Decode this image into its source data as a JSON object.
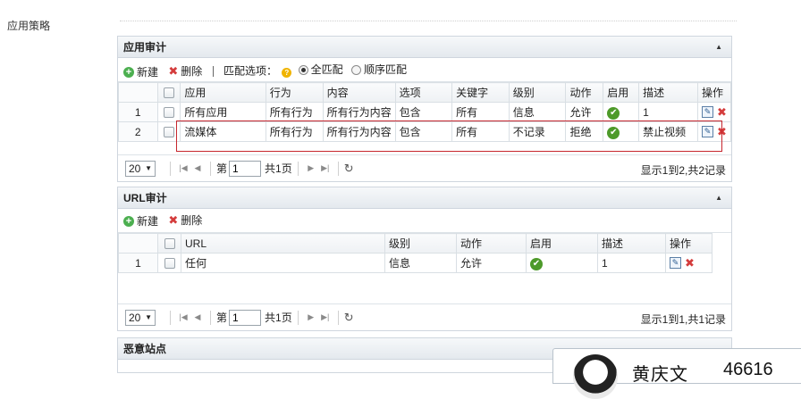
{
  "page": {
    "section_label": "应用策略"
  },
  "app_audit": {
    "title": "应用审计",
    "toolbar": {
      "new_label": "新建",
      "delete_label": "删除",
      "match_label": "匹配选项：",
      "help_glyph": "?",
      "match_all_label": "全匹配",
      "match_seq_label": "顺序匹配"
    },
    "columns": [
      "应用",
      "行为",
      "内容",
      "选项",
      "关键字",
      "级别",
      "动作",
      "启用",
      "描述",
      "操作"
    ],
    "rows": [
      {
        "num": "1",
        "app": "所有应用",
        "behavior": "所有行为",
        "content": "所有行为内容",
        "option": "包含",
        "keyword": "所有",
        "level": "信息",
        "action": "允许",
        "desc": "1"
      },
      {
        "num": "2",
        "app": "流媒体",
        "behavior": "所有行为",
        "content": "所有行为内容",
        "option": "包含",
        "keyword": "所有",
        "level": "不记录",
        "action": "拒绝",
        "desc": "禁止视频"
      }
    ],
    "pager": {
      "page_size": "20",
      "page_prefix": "第",
      "page_value": "1",
      "page_suffix": "共1页",
      "info": "显示1到2,共2记录"
    }
  },
  "url_audit": {
    "title": "URL审计",
    "toolbar": {
      "new_label": "新建",
      "delete_label": "删除"
    },
    "columns": [
      "URL",
      "级别",
      "动作",
      "启用",
      "描述",
      "操作"
    ],
    "rows": [
      {
        "num": "1",
        "url": "任何",
        "level": "信息",
        "action": "允许",
        "desc": "1"
      }
    ],
    "pager": {
      "page_size": "20",
      "page_prefix": "第",
      "page_value": "1",
      "page_suffix": "共1页",
      "info": "显示1到1,共1记录"
    }
  },
  "malicious_sites": {
    "title": "恶意站点"
  },
  "popup": {
    "name": "黄庆文",
    "number": "46616"
  },
  "colors": {
    "accent_red": "#c6262e",
    "ok_green": "#4d9a2a",
    "header_bg": "#e4e9ee"
  }
}
